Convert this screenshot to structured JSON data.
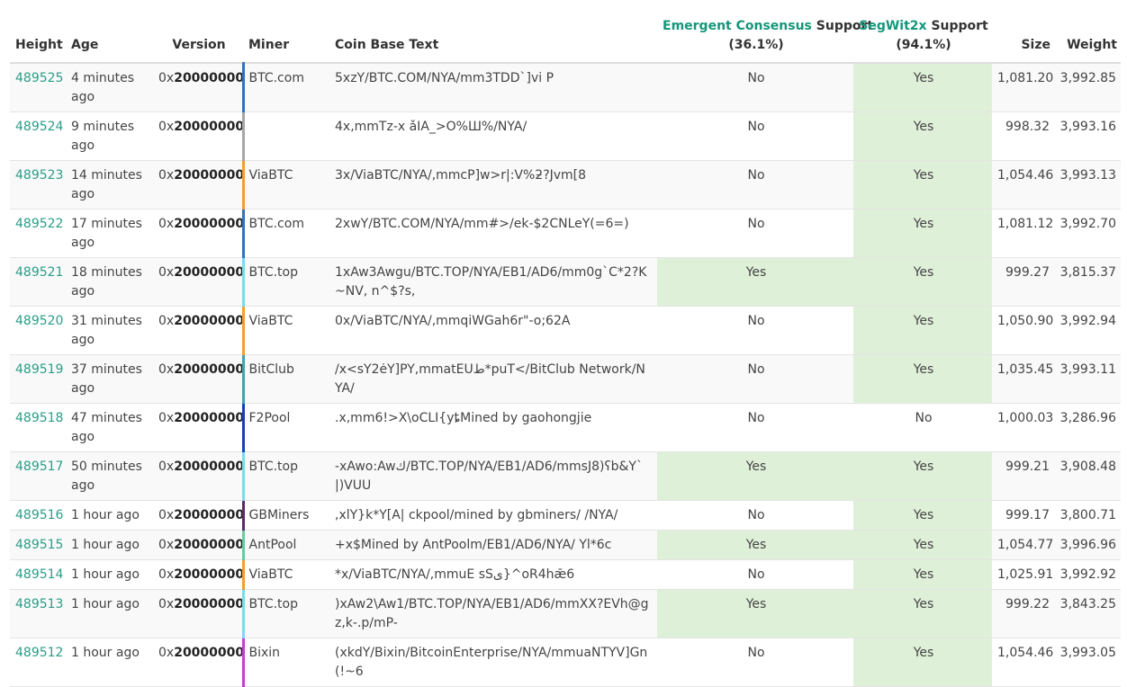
{
  "header": {
    "height": "Height",
    "age": "Age",
    "version": "Version",
    "miner": "Miner",
    "coinbase": "Coin Base Text",
    "ec_name": "Emergent Consensus",
    "ec_support": "Support",
    "ec_pct": "(36.1%)",
    "sw_name": "SegWit2x",
    "sw_support": "Support",
    "sw_pct": "(94.1%)",
    "size": "Size",
    "weight": "Weight"
  },
  "colors": {
    "pool_btccom": "#3a6fb5",
    "pool_unknown": "#a6a6a6",
    "pool_viabtc": "#f0a030",
    "pool_btctop": "#80d8f0",
    "pool_bitclub": "#4aa0a8",
    "pool_f2pool": "#1840b0",
    "pool_gbminers": "#5a2a6a",
    "pool_antpool": "#6cc8a0",
    "pool_bixin": "#c040d0",
    "support_yes_bg": "#dff0d8",
    "link": "#2d9c88"
  },
  "blocks": [
    {
      "height": "489525",
      "age": "4 minutes ago",
      "version_prefix": "0x",
      "version": "20000000",
      "miner": "BTC.com",
      "pool_color": "#3a6fb5",
      "coinbase": "5xzY/BTC.COM/NYA/mm3TDD`]vi P",
      "ec": "No",
      "sw": "Yes",
      "size": "1,081.20",
      "weight": "3,992.85"
    },
    {
      "height": "489524",
      "age": "9 minutes ago",
      "version_prefix": "0x",
      "version": "20000000",
      "miner": "",
      "pool_color": "#a6a6a6",
      "coinbase": "4x,mmTz-x ǎIA_>O%Ш%/NYA/",
      "ec": "No",
      "sw": "Yes",
      "size": "998.32",
      "weight": "3,993.16"
    },
    {
      "height": "489523",
      "age": "14 minutes ago",
      "version_prefix": "0x",
      "version": "20000000",
      "miner": "ViaBTC",
      "pool_color": "#f0a030",
      "coinbase": "3x/ViaBTC/NYA/,mmcP]w>r|:V%ƻ?Jvm[8",
      "ec": "No",
      "sw": "Yes",
      "size": "1,054.46",
      "weight": "3,993.13"
    },
    {
      "height": "489522",
      "age": "17 minutes ago",
      "version_prefix": "0x",
      "version": "20000000",
      "miner": "BTC.com",
      "pool_color": "#3a6fb5",
      "coinbase": "2xwY/BTC.COM/NYA/mm#>/ek-$2CNLeY(=6=)",
      "ec": "No",
      "sw": "Yes",
      "size": "1,081.12",
      "weight": "3,992.70"
    },
    {
      "height": "489521",
      "age": "18 minutes ago",
      "version_prefix": "0x",
      "version": "20000000",
      "miner": "BTC.top",
      "pool_color": "#80d8f0",
      "coinbase": "1xAw3Awgu/BTC.TOP/NYA/EB1/AD6/mm0g`C*2?K~NV, n^$?s,",
      "ec": "Yes",
      "sw": "Yes",
      "size": "999.27",
      "weight": "3,815.37"
    },
    {
      "height": "489520",
      "age": "31 minutes ago",
      "version_prefix": "0x",
      "version": "20000000",
      "miner": "ViaBTC",
      "pool_color": "#f0a030",
      "coinbase": "0x/ViaBTC/NYA/,mmqiWGah6r\"-o;62A",
      "ec": "No",
      "sw": "Yes",
      "size": "1,050.90",
      "weight": "3,992.94"
    },
    {
      "height": "489519",
      "age": "37 minutes ago",
      "version_prefix": "0x",
      "version": "20000000",
      "miner": "BitClub",
      "pool_color": "#4aa0a8",
      "coinbase": "/x<sY2ėY]PY,mmatEUط*puT</BitClub Network/NYA/",
      "ec": "No",
      "sw": "Yes",
      "size": "1,035.45",
      "weight": "3,993.11"
    },
    {
      "height": "489518",
      "age": "47 minutes ago",
      "version_prefix": "0x",
      "version": "20000000",
      "miner": "F2Pool",
      "pool_color": "#1840b0",
      "coinbase": ".x,mm6!>X\\oCLI{yȶMined by gaohongjie",
      "ec": "No",
      "sw": "No",
      "size": "1,000.03",
      "weight": "3,286.96"
    },
    {
      "height": "489517",
      "age": "50 minutes ago",
      "version_prefix": "0x",
      "version": "20000000",
      "miner": "BTC.top",
      "pool_color": "#80d8f0",
      "coinbase": "-xAwo:Awك/BTC.TOP/NYA/EB1/AD6/mmsJ8)ʕb&Y`|)VUU",
      "ec": "Yes",
      "sw": "Yes",
      "size": "999.21",
      "weight": "3,908.48"
    },
    {
      "height": "489516",
      "age": "1 hour ago",
      "version_prefix": "0x",
      "version": "20000000",
      "miner": "GBMiners",
      "pool_color": "#5a2a6a",
      "coinbase": ",xlY}k*Y[A| ckpool/mined by gbminers/ /NYA/",
      "ec": "No",
      "sw": "Yes",
      "size": "999.17",
      "weight": "3,800.71"
    },
    {
      "height": "489515",
      "age": "1 hour ago",
      "version_prefix": "0x",
      "version": "20000000",
      "miner": "AntPool",
      "pool_color": "#6cc8a0",
      "coinbase": "+x$Mined by AntPoolm/EB1/AD6/NYA/ Yl*6c",
      "ec": "Yes",
      "sw": "Yes",
      "size": "1,054.77",
      "weight": "3,996.96"
    },
    {
      "height": "489514",
      "age": "1 hour ago",
      "version_prefix": "0x",
      "version": "20000000",
      "miner": "ViaBTC",
      "pool_color": "#f0a030",
      "coinbase": "*x/ViaBTC/NYA/,mmuE sSى}^oR4hǣ6",
      "ec": "No",
      "sw": "Yes",
      "size": "1,025.91",
      "weight": "3,992.92"
    },
    {
      "height": "489513",
      "age": "1 hour ago",
      "version_prefix": "0x",
      "version": "20000000",
      "miner": "BTC.top",
      "pool_color": "#80d8f0",
      "coinbase": ")xAw2\\Aw1/BTC.TOP/NYA/EB1/AD6/mmXX?EVh@gz,k-.p/mP-",
      "ec": "Yes",
      "sw": "Yes",
      "size": "999.22",
      "weight": "3,843.25"
    },
    {
      "height": "489512",
      "age": "1 hour ago",
      "version_prefix": "0x",
      "version": "20000000",
      "miner": "Bixin",
      "pool_color": "#c040d0",
      "coinbase": "(xkdY/Bixin/BitcoinEnterprise/NYA/mmuaNTYV]Gn(!~6",
      "ec": "No",
      "sw": "Yes",
      "size": "1,054.46",
      "weight": "3,993.05"
    }
  ]
}
